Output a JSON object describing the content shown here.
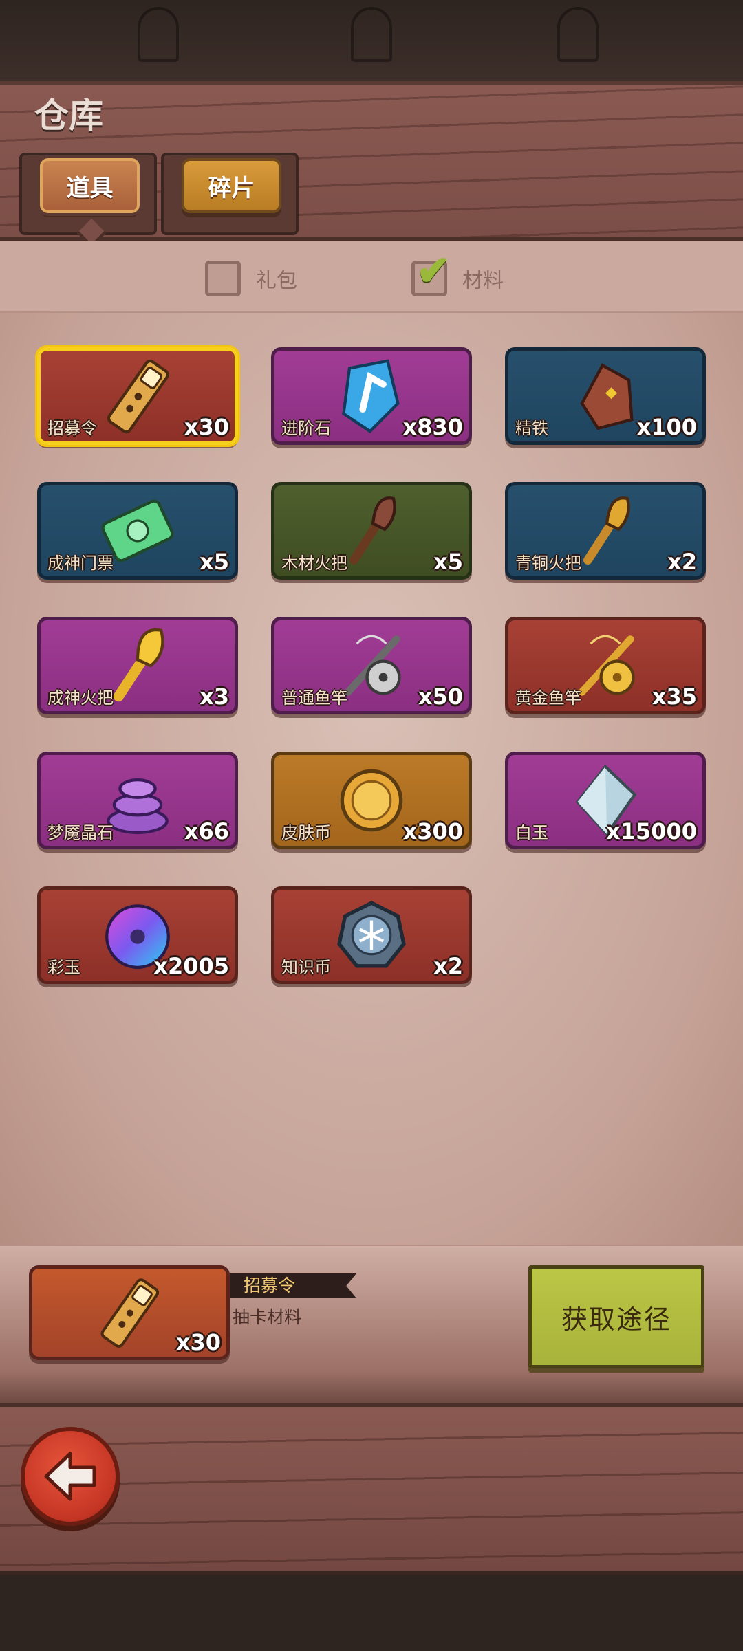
{
  "header": {
    "title": "仓库"
  },
  "tabs": [
    {
      "label": "道具",
      "active": true
    },
    {
      "label": "碎片",
      "active": false
    }
  ],
  "filters": [
    {
      "label": "礼包",
      "checked": false
    },
    {
      "label": "材料",
      "checked": true
    }
  ],
  "items": [
    {
      "name": "招募令",
      "count": "x30",
      "rarity": "red",
      "icon": "recruit-token-icon",
      "selected": true
    },
    {
      "name": "进阶石",
      "count": "x830",
      "rarity": "purple",
      "icon": "advance-stone-icon"
    },
    {
      "name": "精铁",
      "count": "x100",
      "rarity": "blue",
      "icon": "refined-iron-icon"
    },
    {
      "name": "成神门票",
      "count": "x5",
      "rarity": "blue",
      "icon": "ticket-icon"
    },
    {
      "name": "木材火把",
      "count": "x5",
      "rarity": "green",
      "icon": "wood-torch-icon"
    },
    {
      "name": "青铜火把",
      "count": "x2",
      "rarity": "blue",
      "icon": "bronze-torch-icon"
    },
    {
      "name": "成神火把",
      "count": "x3",
      "rarity": "purple",
      "icon": "golden-torch-icon"
    },
    {
      "name": "普通鱼竿",
      "count": "x50",
      "rarity": "purple",
      "icon": "fishing-rod-icon"
    },
    {
      "name": "黄金鱼竿",
      "count": "x35",
      "rarity": "red",
      "icon": "golden-fishing-rod-icon"
    },
    {
      "name": "梦魇晶石",
      "count": "x66",
      "rarity": "purple",
      "icon": "nightmare-crystal-icon"
    },
    {
      "name": "皮肤币",
      "count": "x300",
      "rarity": "orange",
      "icon": "skin-coin-icon"
    },
    {
      "name": "白玉",
      "count": "x15000",
      "rarity": "purple",
      "icon": "white-jade-icon"
    },
    {
      "name": "彩玉",
      "count": "x2005",
      "rarity": "red",
      "icon": "color-jade-icon"
    },
    {
      "name": "知识币",
      "count": "x2",
      "rarity": "red",
      "icon": "knowledge-coin-icon"
    }
  ],
  "detail": {
    "name": "招募令",
    "description": "抽卡材料",
    "count": "x30",
    "icon": "recruit-token-icon",
    "source_button_label": "获取途径"
  },
  "colors": {
    "selected_border": "#f6d11c",
    "rarity_red": "#a84135",
    "rarity_purple": "#a13c95",
    "rarity_blue": "#27506c",
    "rarity_green": "#4f5f2d",
    "rarity_orange": "#bb7a28",
    "source_button": "#bcc646",
    "back_button": "#e7543a"
  },
  "back_button": {
    "icon": "back-arrow-icon"
  }
}
